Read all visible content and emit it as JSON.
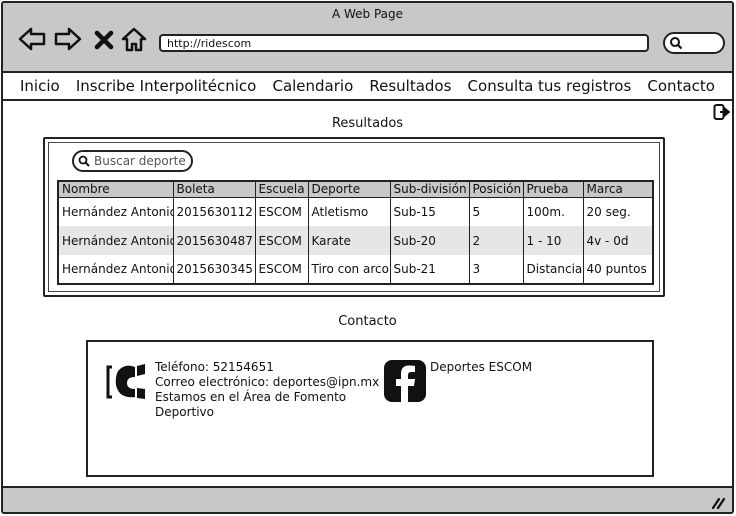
{
  "browser": {
    "window_title": "A Web Page",
    "url": "http://ridescom"
  },
  "menu": {
    "items": [
      {
        "label": "Inicio"
      },
      {
        "label": "Inscribe Interpolitécnico"
      },
      {
        "label": "Calendario"
      },
      {
        "label": "Resultados"
      },
      {
        "label": "Consulta tus registros"
      },
      {
        "label": "Contacto"
      }
    ]
  },
  "results": {
    "title": "Resultados",
    "search_placeholder": "Buscar deporte",
    "columns": [
      "Nombre",
      "Boleta",
      "Escuela",
      "Deporte",
      "Sub-división",
      "Posición",
      "Prueba",
      "Marca"
    ],
    "rows": [
      [
        "Hernández Antonio",
        "2015630112",
        "ESCOM",
        "Atletismo",
        "Sub-15",
        "5",
        "100m.",
        "20 seg."
      ],
      [
        "Hernández Antonio",
        "2015630487",
        "ESCOM",
        "Karate",
        "Sub-20",
        "2",
        "1 - 10",
        "4v - 0d"
      ],
      [
        "Hernández Antonio",
        "2015630345",
        "ESCOM",
        "Tiro con arco",
        "Sub-21",
        "3",
        "Distancia",
        "40 puntos"
      ]
    ]
  },
  "contact": {
    "title": "Contacto",
    "phone": "Teléfono: 52154651",
    "email": "Correo electrónico: deportes@ipn.mx",
    "location_line1": "Estamos en el Área de Fomento",
    "location_line2": "Deportivo",
    "facebook_label": "Deportes ESCOM"
  },
  "icons": {
    "back": "arrow-left-icon",
    "forward": "arrow-right-icon",
    "stop": "close-icon",
    "home": "home-icon",
    "search": "search-icon",
    "logout": "logout-icon",
    "phone": "phone-icon",
    "facebook": "facebook-icon",
    "resize": "resize-grip-icon"
  }
}
